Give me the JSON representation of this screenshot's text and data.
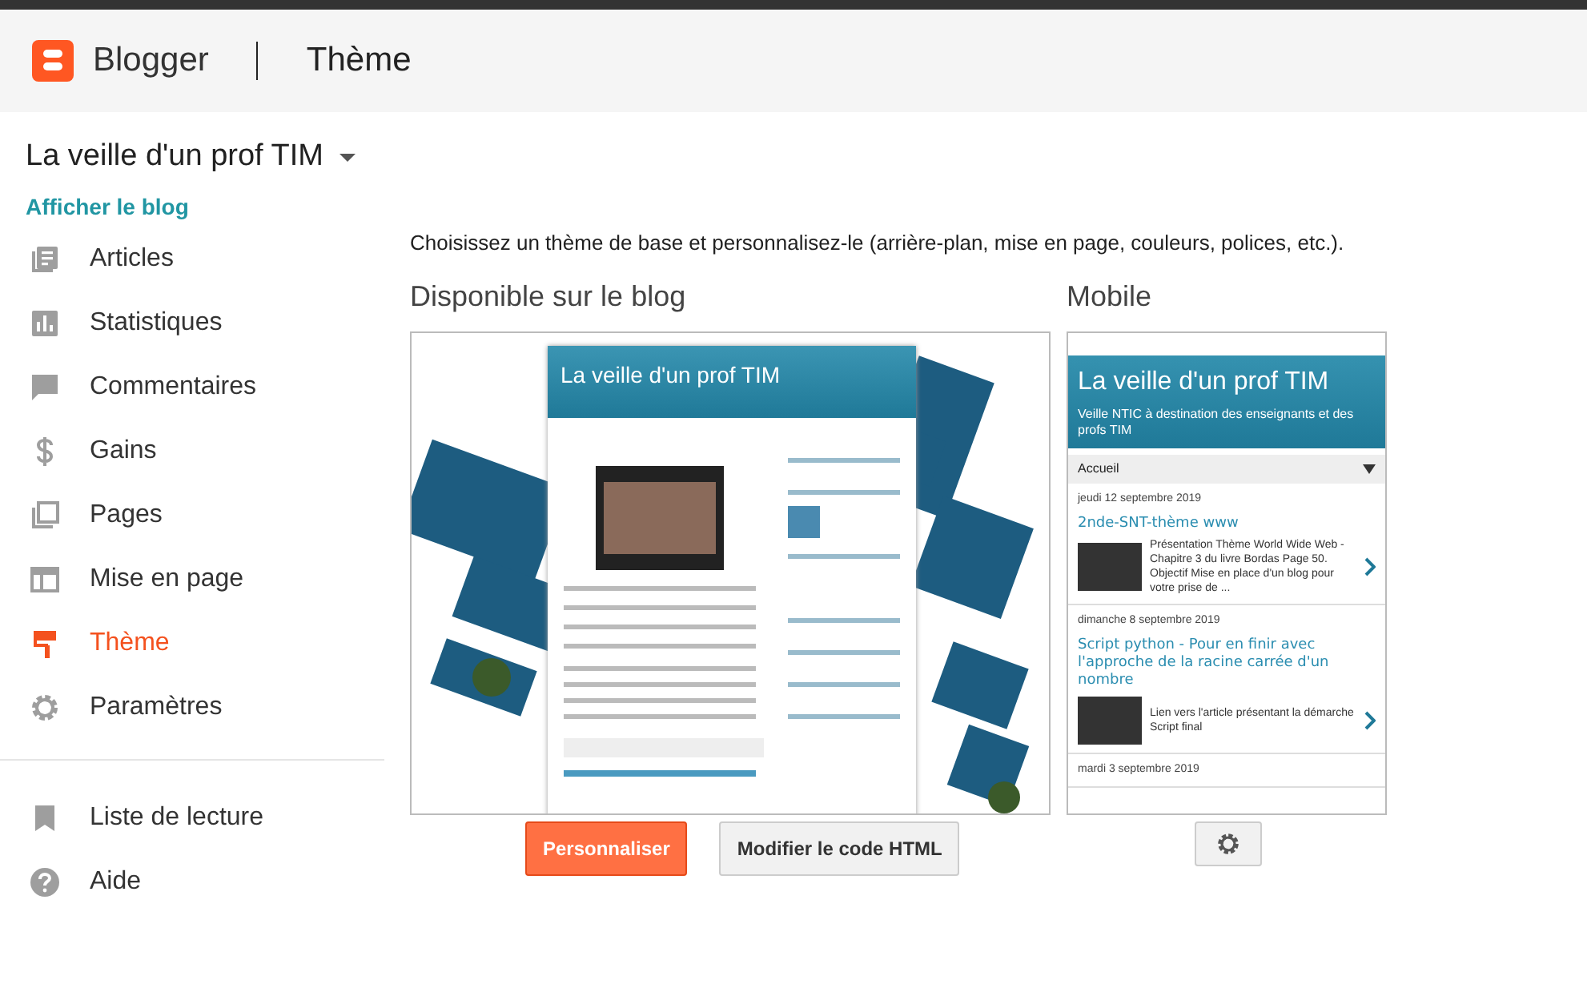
{
  "header": {
    "app_name": "Blogger",
    "page_title": "Thème"
  },
  "sidebar": {
    "blog_name": "La veille d'un prof TIM",
    "view_link": "Afficher le blog",
    "items": [
      {
        "label": "Articles",
        "selected": false
      },
      {
        "label": "Statistiques",
        "selected": false
      },
      {
        "label": "Commentaires",
        "selected": false
      },
      {
        "label": "Gains",
        "selected": false
      },
      {
        "label": "Pages",
        "selected": false
      },
      {
        "label": "Mise en page",
        "selected": false
      },
      {
        "label": "Thème",
        "selected": true
      },
      {
        "label": "Paramètres",
        "selected": false
      }
    ],
    "bottom_items": [
      {
        "label": "Liste de lecture"
      },
      {
        "label": "Aide"
      }
    ]
  },
  "intro": "Choisissez un thème de base et personnalisez-le (arrière-plan, mise en page, couleurs, polices, etc.).",
  "desktop": {
    "heading": "Disponible sur le blog",
    "preview_title": "La veille d'un prof TIM",
    "buttons": [
      {
        "label": "Personnaliser",
        "kind": "primary"
      },
      {
        "label": "Modifier le code HTML",
        "kind": "secondary"
      }
    ]
  },
  "mobile": {
    "heading": "Mobile",
    "blog_title": "La veille d'un prof TIM",
    "blog_subtitle": "Veille NTIC à destination des enseignants et des profs TIM",
    "tab": "Accueil",
    "posts": [
      {
        "date": "jeudi 12 septembre 2019",
        "title": "2nde-SNT-thème www",
        "excerpt": "Présentation Thème World Wide Web - Chapitre 3 du livre Bordas Page 50. Objectif  Mise en place d'un blog pour votre prise de ..."
      },
      {
        "date": "dimanche 8 septembre 2019",
        "title": "Script python - Pour en finir avec l'approche de la racine carrée d'un nombre",
        "excerpt": "Lien vers l'article présentant la démarche Script final"
      },
      {
        "date": "mardi 3 septembre 2019"
      }
    ]
  }
}
